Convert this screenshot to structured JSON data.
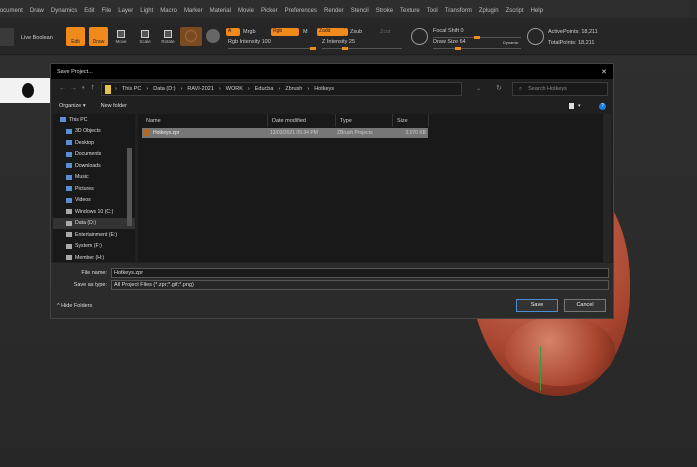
{
  "menu": [
    "Document",
    "Draw",
    "Dynamics",
    "Edit",
    "File",
    "Layer",
    "Light",
    "Macro",
    "Marker",
    "Material",
    "Movie",
    "Picker",
    "Preferences",
    "Render",
    "Stencil",
    "Stroke",
    "Texture",
    "Tool",
    "Transform",
    "Zplugin",
    "Zscript",
    "Help"
  ],
  "toolbar": {
    "live_boolean": "Live Boolean",
    "edit": "Edit",
    "draw": "Draw",
    "move": "Move",
    "scale": "Scale",
    "rotate": "Rotate",
    "a": "A",
    "mrgb": "Mrgb",
    "rgb": "Rgb",
    "m": "M",
    "zadd": "Zadd",
    "zsub": "Zsub",
    "zcut": "Zcut",
    "rgb_intensity": "Rgb Intensity 100",
    "z_intensity": "Z Intensity 25",
    "focal_shift": "Focal Shift 0",
    "draw_size": "Draw Size 64",
    "dynamic": "Dynamic",
    "active_points": "ActivePoints: 18,211",
    "total_points": "TotalPoints: 18,211",
    "accent": "#f08a1c"
  },
  "dialog": {
    "title": "Save Project...",
    "close": "✕",
    "breadcrumb": [
      "This PC",
      "Data (D:)",
      "RAVI-2021",
      "WORK",
      "Educba",
      "Zbrush",
      "Hotkeys"
    ],
    "search_placeholder": "Search Hotkeys",
    "organize": "Organize ▾",
    "new_folder": "New folder",
    "nav": [
      "This PC",
      "3D Objects",
      "Desktop",
      "Documents",
      "Downloads",
      "Music",
      "Pictures",
      "Videos",
      "Windows 10 (C:)",
      "Data (D:)",
      "Entertainment (E:)",
      "System (F:)",
      "Member (H:)"
    ],
    "columns": {
      "name": "Name",
      "date": "Date modified",
      "type": "Type",
      "size": "Size"
    },
    "file": {
      "name": "Hotkeys.zpr",
      "date": "13/03/2021 05:34 PM",
      "type": "ZBrush Projects",
      "size": "3,070 KB"
    },
    "file_name_label": "File name:",
    "file_name": "Hotkeys.zpr",
    "save_type_label": "Save as type:",
    "save_type": "All Project Files (*.zpr;*.gif;*.png)",
    "hide_folders": "Hide Folders",
    "save": "Save",
    "cancel": "Cancel"
  }
}
